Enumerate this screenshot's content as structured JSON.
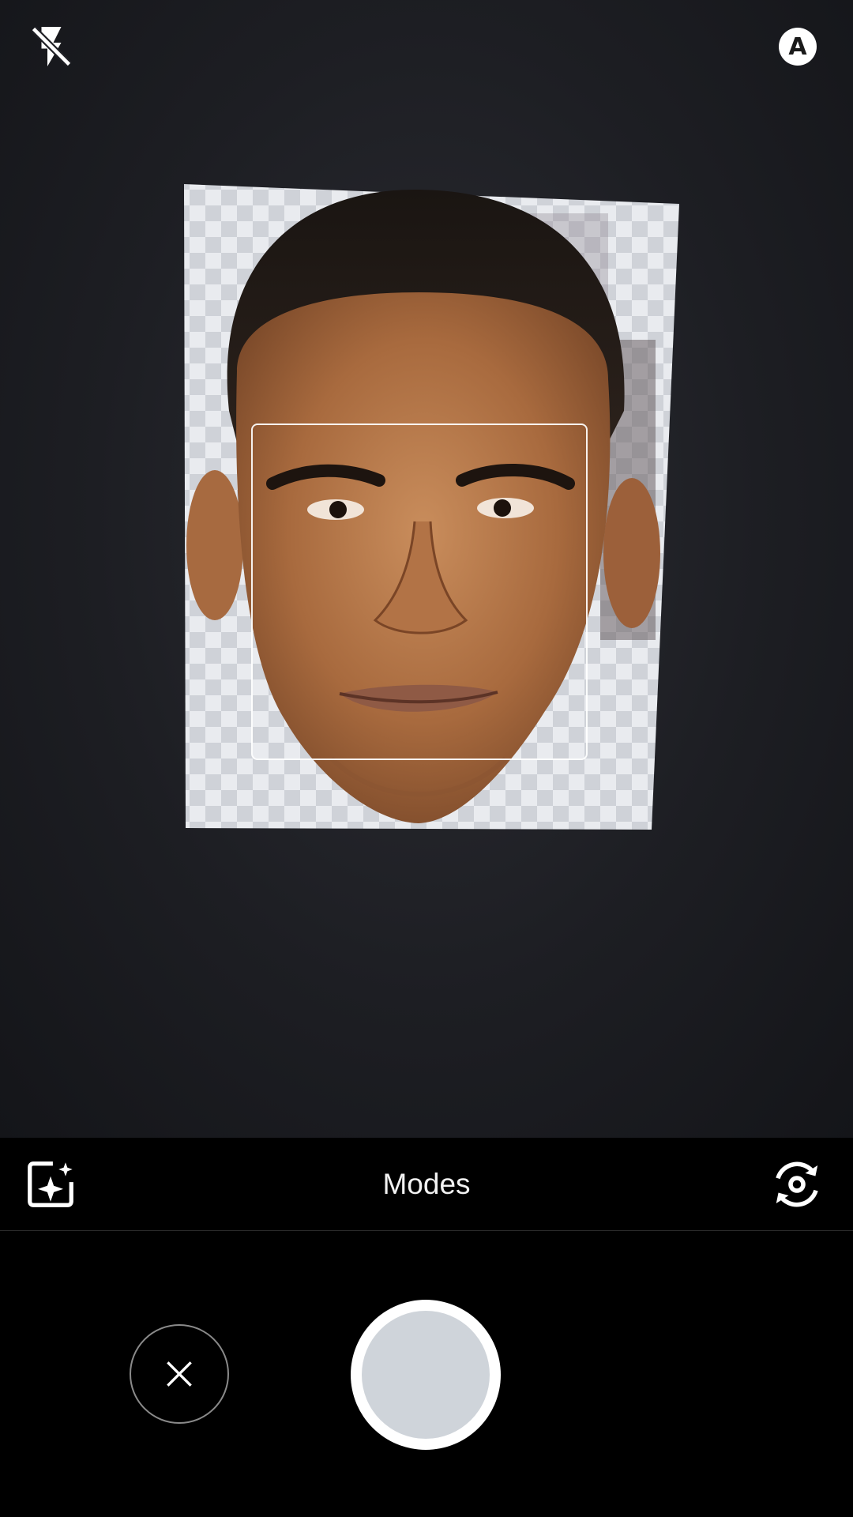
{
  "top_bar": {
    "flash_icon": "flash-off-icon",
    "auto_badge": "A"
  },
  "viewfinder": {
    "subject": "photo-of-face",
    "face_detection_frame": true
  },
  "modes_bar": {
    "effects_icon": "effects-sparkle-icon",
    "label": "Modes",
    "switch_camera_icon": "switch-camera-icon"
  },
  "controls": {
    "cancel_icon": "close-icon",
    "shutter_icon": "shutter-button"
  },
  "colors": {
    "background": "#000000",
    "shutter_outer": "#ffffff",
    "shutter_inner": "#cfd4da",
    "text": "#f2f2f2"
  }
}
